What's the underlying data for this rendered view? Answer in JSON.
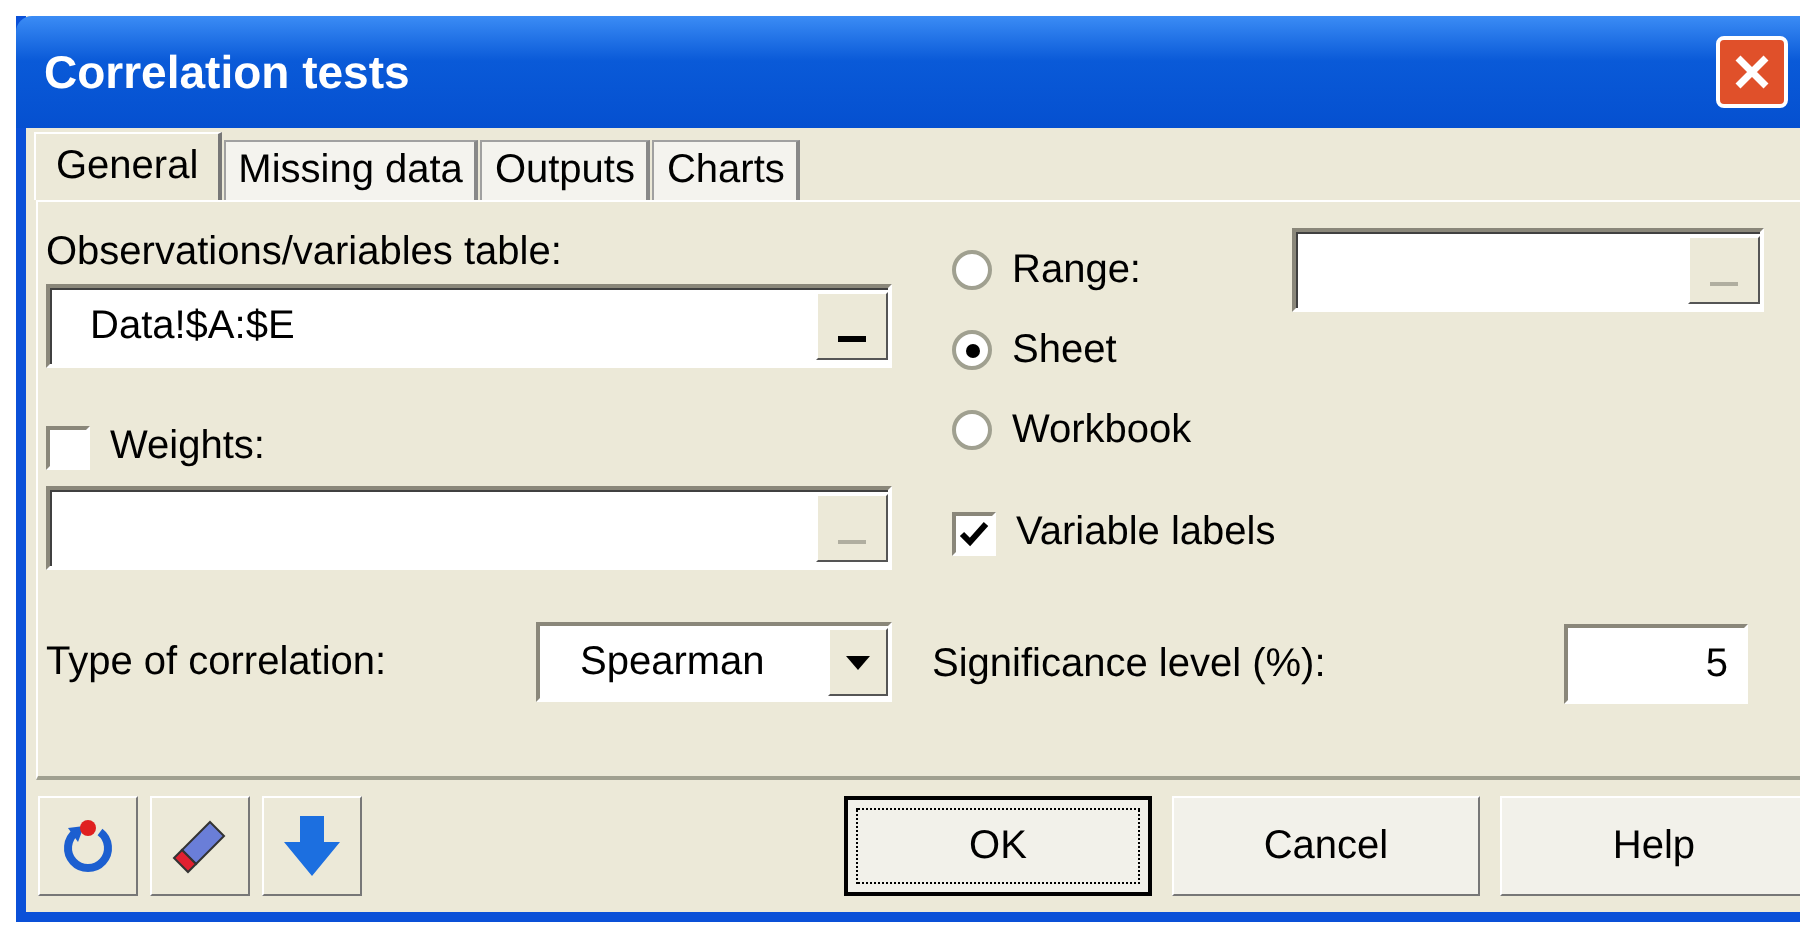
{
  "window": {
    "title": "Correlation tests"
  },
  "tabs": [
    {
      "label": "General",
      "selected": true
    },
    {
      "label": "Missing data",
      "selected": false
    },
    {
      "label": "Outputs",
      "selected": false
    },
    {
      "label": "Charts",
      "selected": false
    }
  ],
  "general": {
    "observations_table": {
      "label": "Observations/variables table:",
      "value": "Data!$A:$E"
    },
    "weights": {
      "label": "Weights:",
      "checked": false
    },
    "correlation_type": {
      "label": "Type of correlation:",
      "value": "Spearman"
    },
    "output_destination": [
      {
        "label": "Range:",
        "selected": false
      },
      {
        "label": "Sheet",
        "selected": true
      },
      {
        "label": "Workbook",
        "selected": false
      }
    ],
    "variable_labels": {
      "label": "Variable labels",
      "checked": true
    },
    "significance_level": {
      "label": "Significance level (%):",
      "value": "5"
    }
  },
  "buttons": [
    {
      "label": "OK",
      "focused": true
    },
    {
      "label": "Cancel",
      "focused": false
    },
    {
      "label": "Help",
      "focused": false
    }
  ]
}
